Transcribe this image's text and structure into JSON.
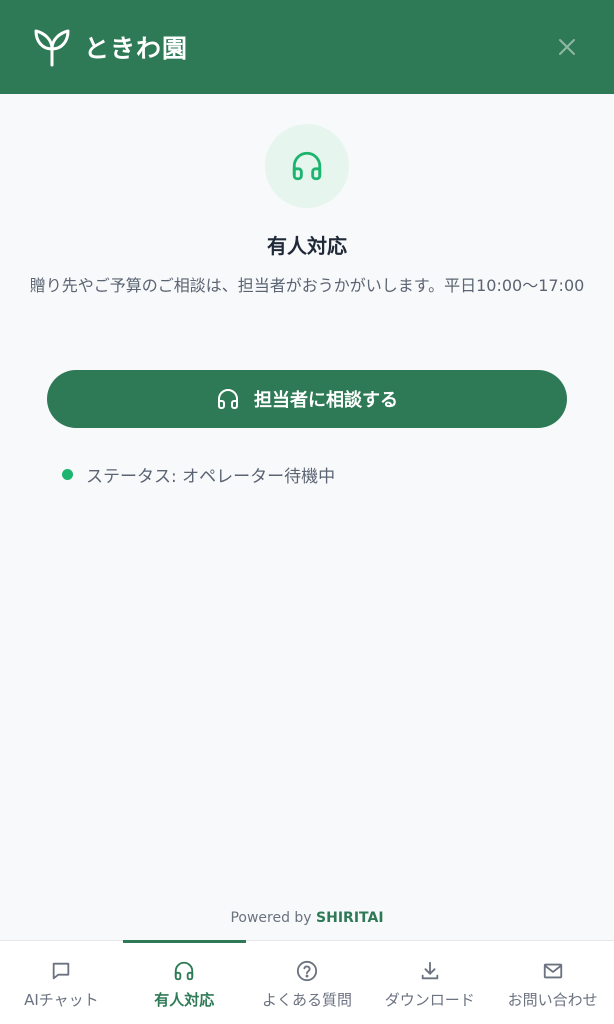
{
  "header": {
    "brand": "ときわ園",
    "logo_icon": "leaf-sprout-icon",
    "close_icon": "close-icon"
  },
  "main": {
    "badge_icon": "headset-icon",
    "title": "有人対応",
    "description": "贈り先やご予算のご相談は、担当者がおうかがいします。平日10:00〜17:00",
    "cta_label": "担当者に相談する",
    "cta_icon": "headset-icon",
    "status_text": "ステータス: オペレーター待機中",
    "status_color": "#1cb46e"
  },
  "footer": {
    "powered_prefix": "Powered by",
    "powered_brand": "SHIRITAI"
  },
  "tabs": [
    {
      "label": "AIチャット",
      "icon": "chat-bubble-icon",
      "active": false
    },
    {
      "label": "有人対応",
      "icon": "headset-icon",
      "active": true
    },
    {
      "label": "よくある質問",
      "icon": "help-circle-icon",
      "active": false
    },
    {
      "label": "ダウンロード",
      "icon": "download-icon",
      "active": false
    },
    {
      "label": "お問い合わせ",
      "icon": "mail-icon",
      "active": false
    }
  ],
  "colors": {
    "primary": "#2f7a56",
    "badge_bg": "#e6f6ee",
    "accent_icon": "#1cb46e",
    "background": "#f8f9fb"
  }
}
